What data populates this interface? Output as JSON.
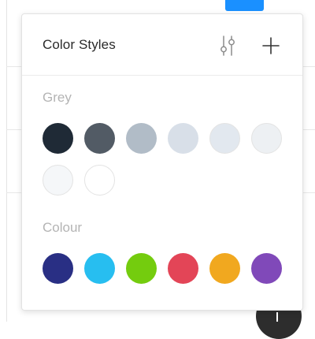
{
  "panel": {
    "title": "Color Styles",
    "actions": {
      "filter_icon": "sliders-icon",
      "add_icon": "plus-icon"
    }
  },
  "sections": [
    {
      "title": "Grey",
      "swatches": [
        "#1f2a36",
        "#525b65",
        "#b1bcc7",
        "#d8dfe8",
        "#e2e8ef",
        "#edf0f3",
        "#f5f7f9",
        "#ffffff"
      ]
    },
    {
      "title": "Colour",
      "swatches": [
        "#292f84",
        "#27bef0",
        "#74cc0e",
        "#e34557",
        "#f1a81f",
        "#8049b9"
      ]
    }
  ]
}
